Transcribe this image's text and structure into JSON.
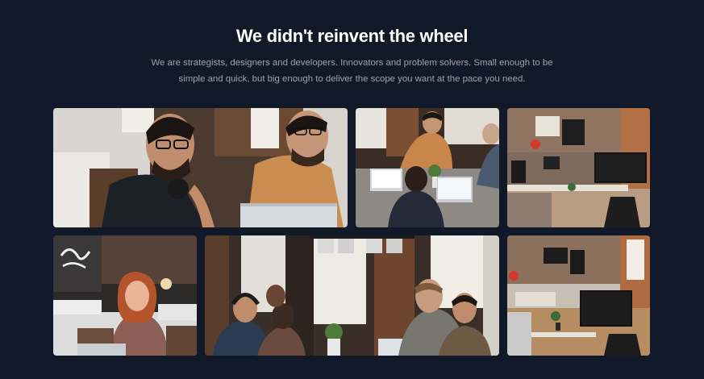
{
  "section": {
    "title": "We didn't reinvent the wheel",
    "description": "We are strategists, designers and developers. Innovators and problem solvers. Small enough to be simple and quick, but big enough to deliver the scope you want at the pace you need."
  },
  "gallery": {
    "photos": [
      {
        "icon": "photo-two-men-headphones-laptop"
      },
      {
        "icon": "photo-coworkers-at-desks-laptops"
      },
      {
        "icon": "photo-empty-office-monitors"
      },
      {
        "icon": "photo-woman-laughing-laptop-neon"
      },
      {
        "icon": "photo-team-meeting-table"
      },
      {
        "icon": "photo-open-office-brick-wall"
      }
    ]
  },
  "colors": {
    "background": "#111827",
    "heading": "#ffffff",
    "body_text": "#9ca3af"
  }
}
